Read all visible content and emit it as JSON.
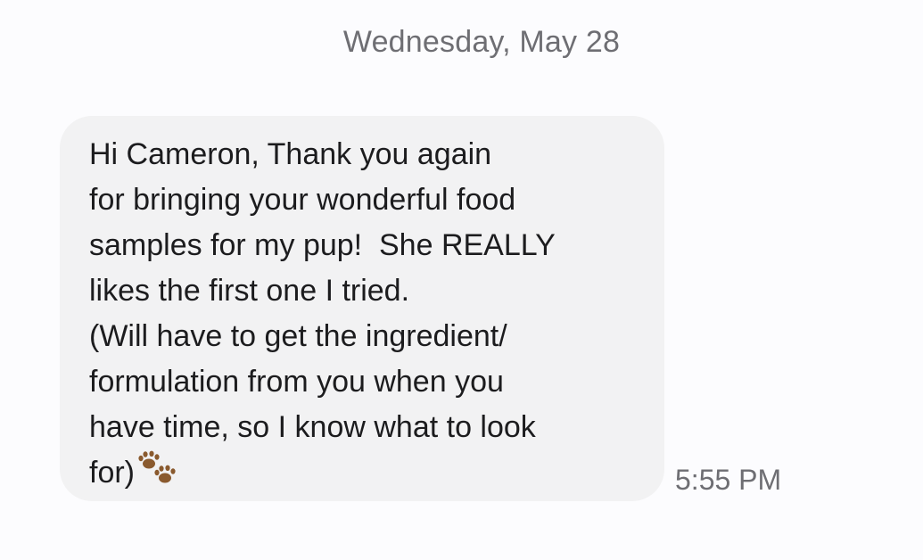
{
  "thread": {
    "date_header": "Wednesday, May 28",
    "messages": [
      {
        "text": "Hi Cameron, Thank you again\nfor bringing your wonderful food\nsamples for my pup!  She REALLY\nlikes the first one I tried.\n(Will have to get the ingredient/\nformulation from you when you\nhave time, so I know what to look\nfor)",
        "trailing_icon": "paw-prints-icon",
        "time": "5:55 PM"
      }
    ]
  },
  "colors": {
    "background": "#fcfcfe",
    "bubble": "#f2f2f3",
    "text": "#1c1c1e",
    "meta_text": "#6e6e73",
    "paw": "#8a5a2e"
  }
}
